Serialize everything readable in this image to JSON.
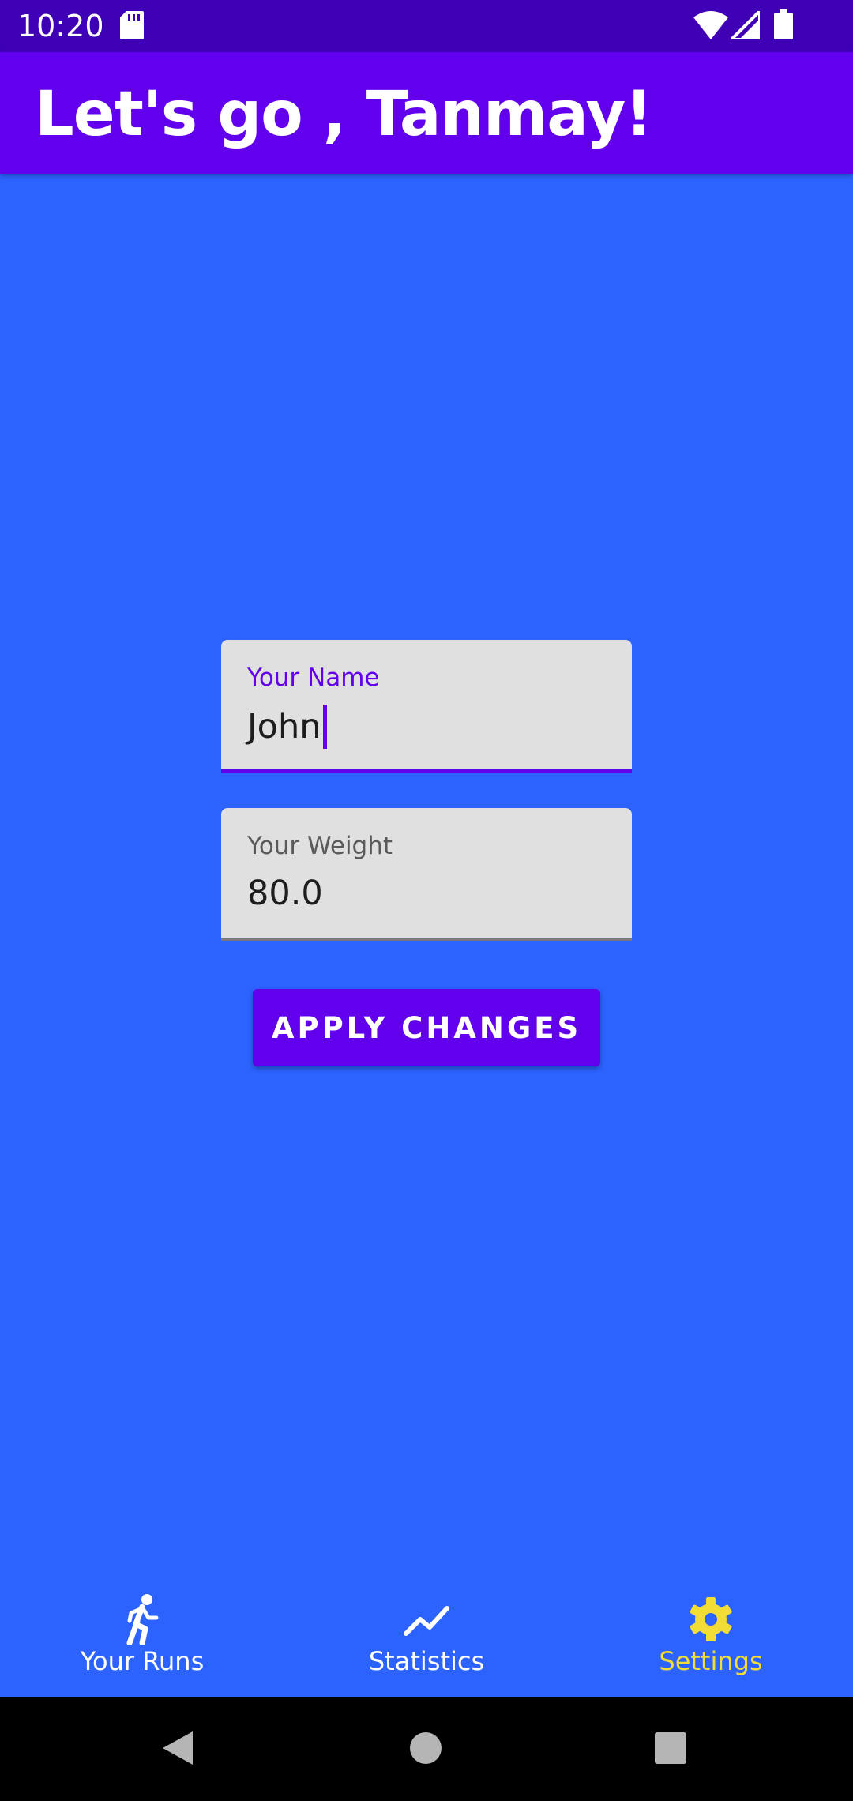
{
  "status_bar": {
    "time": "10:20",
    "icons": [
      "sd-card-icon",
      "wifi-icon",
      "signal-icon",
      "battery-icon"
    ]
  },
  "app_bar": {
    "title": "Let's go , Tanmay!"
  },
  "form": {
    "name_field": {
      "label": "Your Name",
      "value": "John",
      "focused": true
    },
    "weight_field": {
      "label": "Your Weight",
      "value": "80.0",
      "focused": false
    },
    "apply_button_label": "APPLY CHANGES"
  },
  "bottom_nav": {
    "items": [
      {
        "label": "Your Runs",
        "icon": "running-person-icon",
        "selected": false
      },
      {
        "label": "Statistics",
        "icon": "trending-up-icon",
        "selected": false
      },
      {
        "label": "Settings",
        "icon": "gear-icon",
        "selected": true
      }
    ]
  },
  "system_nav": {
    "buttons": [
      "back-icon",
      "home-icon",
      "recents-icon"
    ]
  },
  "colors": {
    "status_bar": "#3f00b5",
    "app_bar": "#6200ee",
    "background": "#2c63fe",
    "accent": "#6200ee",
    "nav_selected": "#f2dd37",
    "field_bg": "#e0e0e0"
  }
}
